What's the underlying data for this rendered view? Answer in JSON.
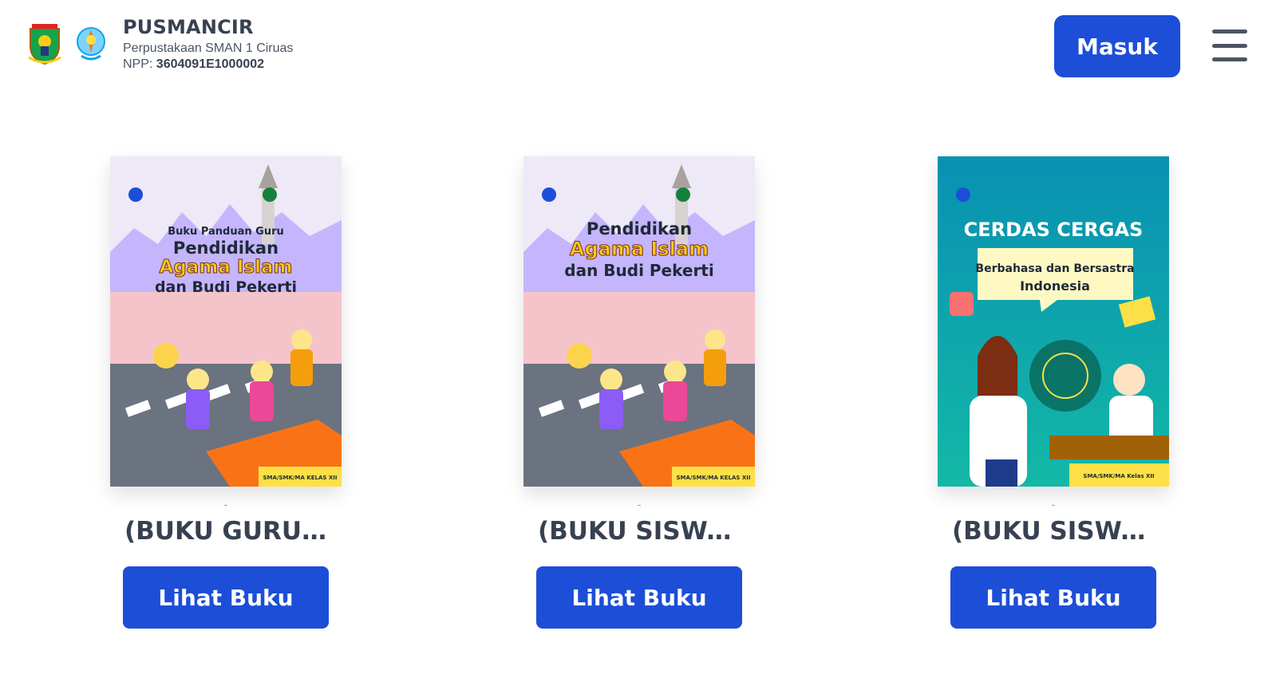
{
  "header": {
    "title": "PUSMANCIR",
    "subtitle": "Perpustakaan SMAN 1 Ciruas",
    "npp_label": "NPP:",
    "npp_value": "3604091E1000002",
    "login_label": "Masuk",
    "icons": [
      "banten-logo",
      "school-logo",
      "hamburger-menu-icon"
    ]
  },
  "books": [
    {
      "title": "(BUKU GURU) ...",
      "dash": "-",
      "button_label": "Lihat Buku",
      "cover": {
        "small": "Buku Panduan Guru",
        "line1": "Pendidikan",
        "line2": "Agama Islam",
        "line3": "dan Budi Pekerti",
        "badge": "SMA/SMK/MA KELAS XII"
      }
    },
    {
      "title": "(BUKU SISWA)...",
      "dash": "-",
      "button_label": "Lihat Buku",
      "cover": {
        "line1": "Pendidikan",
        "line2": "Agama Islam",
        "line3": "dan Budi Pekerti",
        "badge": "SMA/SMK/MA KELAS XII"
      }
    },
    {
      "title": "(BUKU SISWA)...",
      "dash": "-",
      "button_label": "Lihat Buku",
      "cover": {
        "line1": "CERDAS CERGAS",
        "line2": "Berbahasa dan Bersastra",
        "line3": "Indonesia",
        "badge": "SMA/SMK/MA Kelas XII"
      }
    }
  ],
  "colors": {
    "accent": "#1d4ed8",
    "text": "#374151",
    "badge_yellow": "#fde047",
    "teal_cover": "#0f9e8f"
  }
}
